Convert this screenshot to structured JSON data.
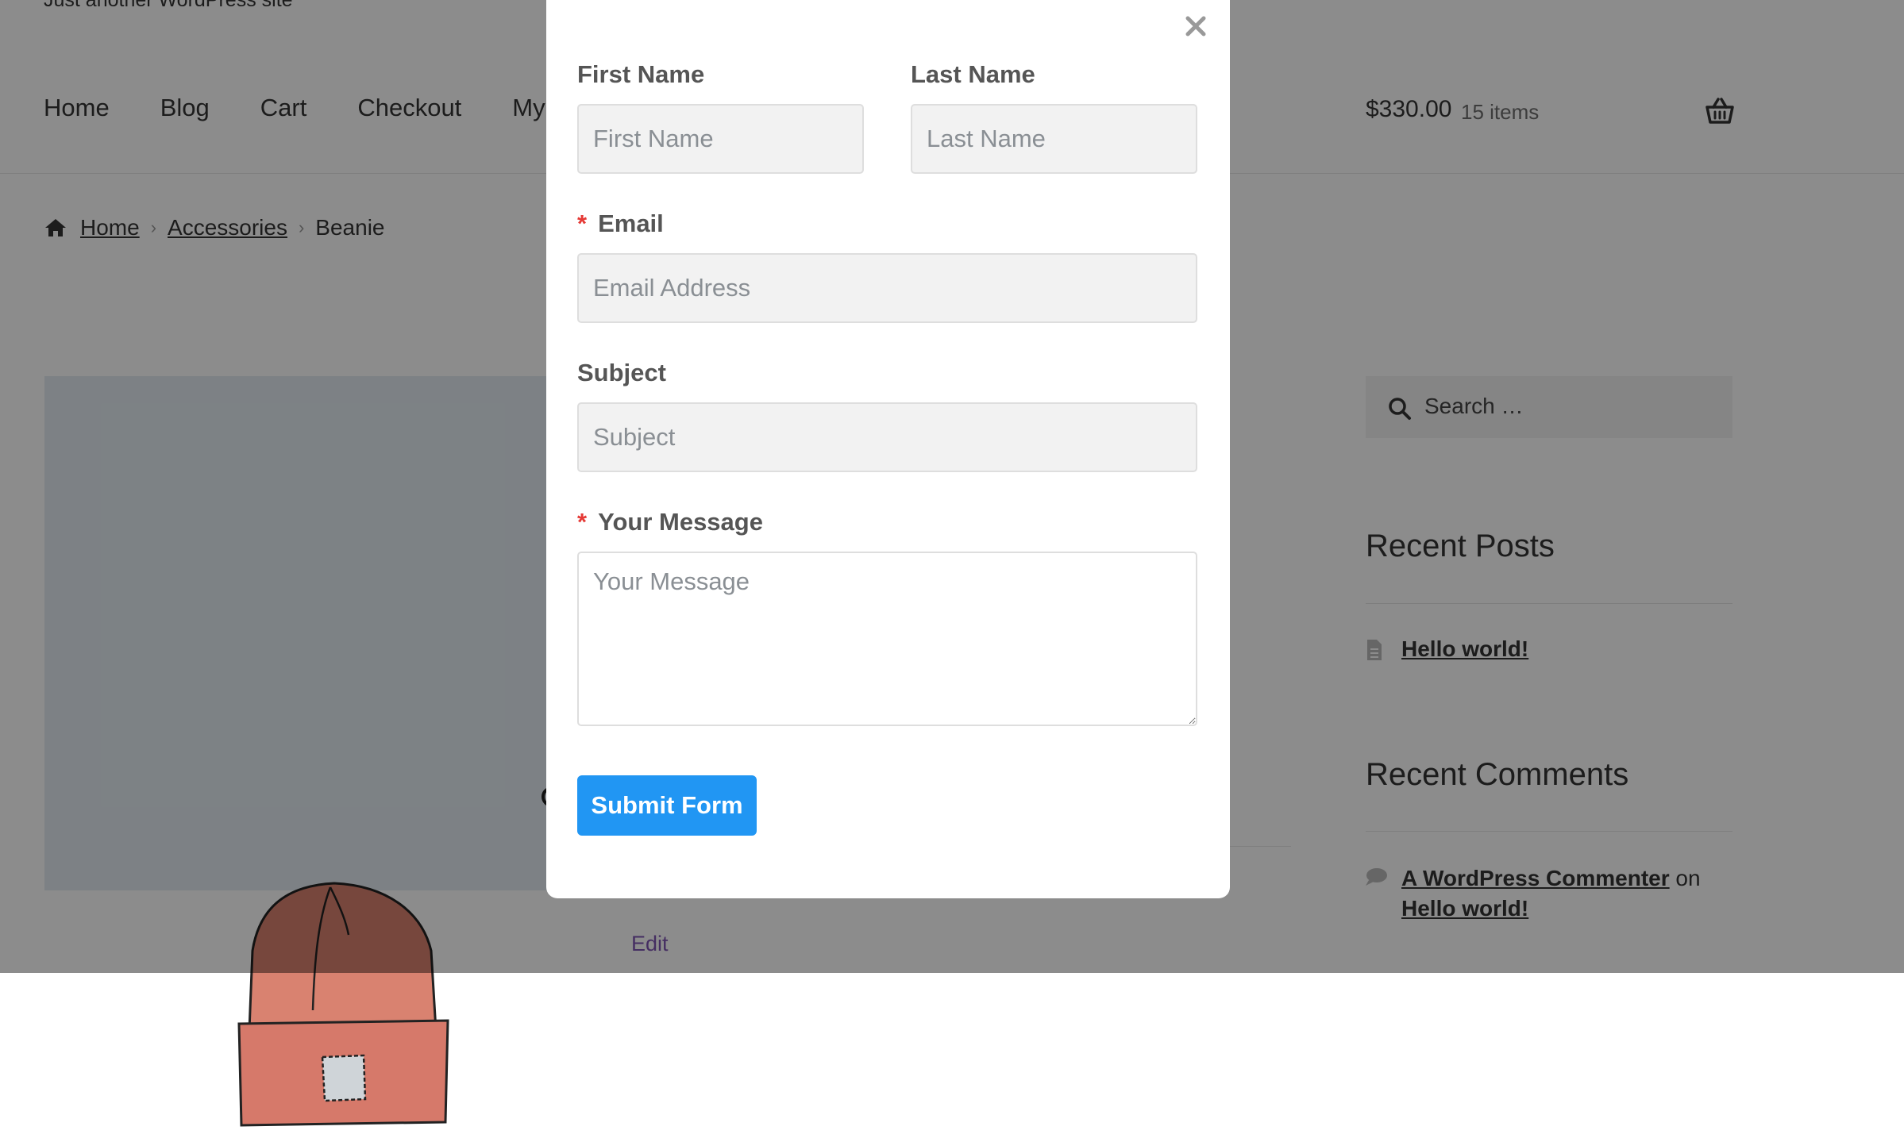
{
  "site": {
    "tagline": "Just another WordPress site"
  },
  "nav": {
    "items": [
      "Home",
      "Blog",
      "Cart",
      "Checkout",
      "My"
    ]
  },
  "cart": {
    "total": "$330.00",
    "count": "15 items"
  },
  "breadcrumb": {
    "items": [
      "Home",
      "Accessories",
      "Beanie"
    ]
  },
  "product": {
    "edit_label": "Edit"
  },
  "sidebar": {
    "search_placeholder": "Search …",
    "recent_posts_title": "Recent Posts",
    "recent_posts": [
      "Hello world!"
    ],
    "recent_comments_title": "Recent Comments",
    "comment": {
      "author": "A WordPress Commenter",
      "on": "on",
      "post": "Hello world!"
    }
  },
  "modal": {
    "first_name": {
      "label": "First Name",
      "placeholder": "First Name",
      "value": ""
    },
    "last_name": {
      "label": "Last Name",
      "placeholder": "Last Name",
      "value": ""
    },
    "email": {
      "required_mark": "*",
      "label": "Email",
      "placeholder": "Email Address",
      "value": ""
    },
    "subject": {
      "label": "Subject",
      "placeholder": "Subject",
      "value": ""
    },
    "message": {
      "required_mark": "*",
      "label": "Your Message",
      "placeholder": "Your Message",
      "value": ""
    },
    "submit_label": "Submit Form",
    "close_icon": "close-icon"
  },
  "colors": {
    "accent": "#2196f3",
    "required": "#e53935",
    "edit_link": "#7f54b3"
  }
}
